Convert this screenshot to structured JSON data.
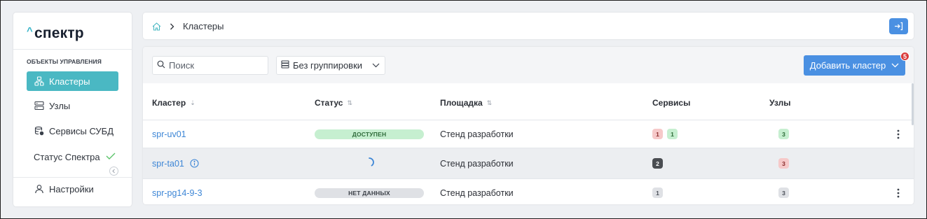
{
  "app": {
    "logo_text": "спектр",
    "logo_caret": "^"
  },
  "sidebar": {
    "section_label": "ОБЪЕКТЫ УПРАВЛЕНИЯ",
    "items": [
      {
        "label": "Кластеры",
        "icon": "cluster-icon",
        "active": true
      },
      {
        "label": "Узлы",
        "icon": "server-icon",
        "active": false
      },
      {
        "label": "Сервисы СУБД",
        "icon": "database-settings-icon",
        "active": false
      },
      {
        "label": "Статус Спектра",
        "icon": "check-icon",
        "active": false
      }
    ],
    "settings_label": "Настройки"
  },
  "breadcrumb": {
    "home_icon": "home-icon",
    "current": "Кластеры"
  },
  "toolbar": {
    "search_placeholder": "Поиск",
    "grouping_label": "Без группировки",
    "add_button_label": "Добавить кластер",
    "add_badge_count": "5"
  },
  "table": {
    "columns": [
      {
        "label": "Кластер",
        "sortable": true
      },
      {
        "label": "Статус",
        "sortable": true
      },
      {
        "label": "Площадка",
        "sortable": true
      },
      {
        "label": "Сервисы",
        "sortable": false
      },
      {
        "label": "Узлы",
        "sortable": false
      }
    ],
    "rows": [
      {
        "name": "spr-uv01",
        "status": "ДОСТУПЕН",
        "site": "Стенд разработки",
        "services": [
          {
            "value": "1",
            "tone": "red"
          },
          {
            "value": "1",
            "tone": "green"
          }
        ],
        "nodes": [
          {
            "value": "3",
            "tone": "green"
          }
        ]
      },
      {
        "name": "spr-ta01",
        "status": "",
        "site": "Стенд разработки",
        "services": [
          {
            "value": "2",
            "tone": "dark"
          }
        ],
        "nodes": [
          {
            "value": "3",
            "tone": "red"
          }
        ]
      },
      {
        "name": "spr-pg14-9-3",
        "status": "НЕТ ДАННЫХ",
        "site": "Стенд разработки",
        "services": [
          {
            "value": "1",
            "tone": "grey"
          }
        ],
        "nodes": [
          {
            "value": "3",
            "tone": "grey"
          }
        ]
      }
    ]
  },
  "colors": {
    "accent": "#4a90e2",
    "active_nav": "#4ab8c3",
    "link": "#3d86d6",
    "status_ok": "#c6efd0",
    "badge_red": "#d93a3a"
  }
}
